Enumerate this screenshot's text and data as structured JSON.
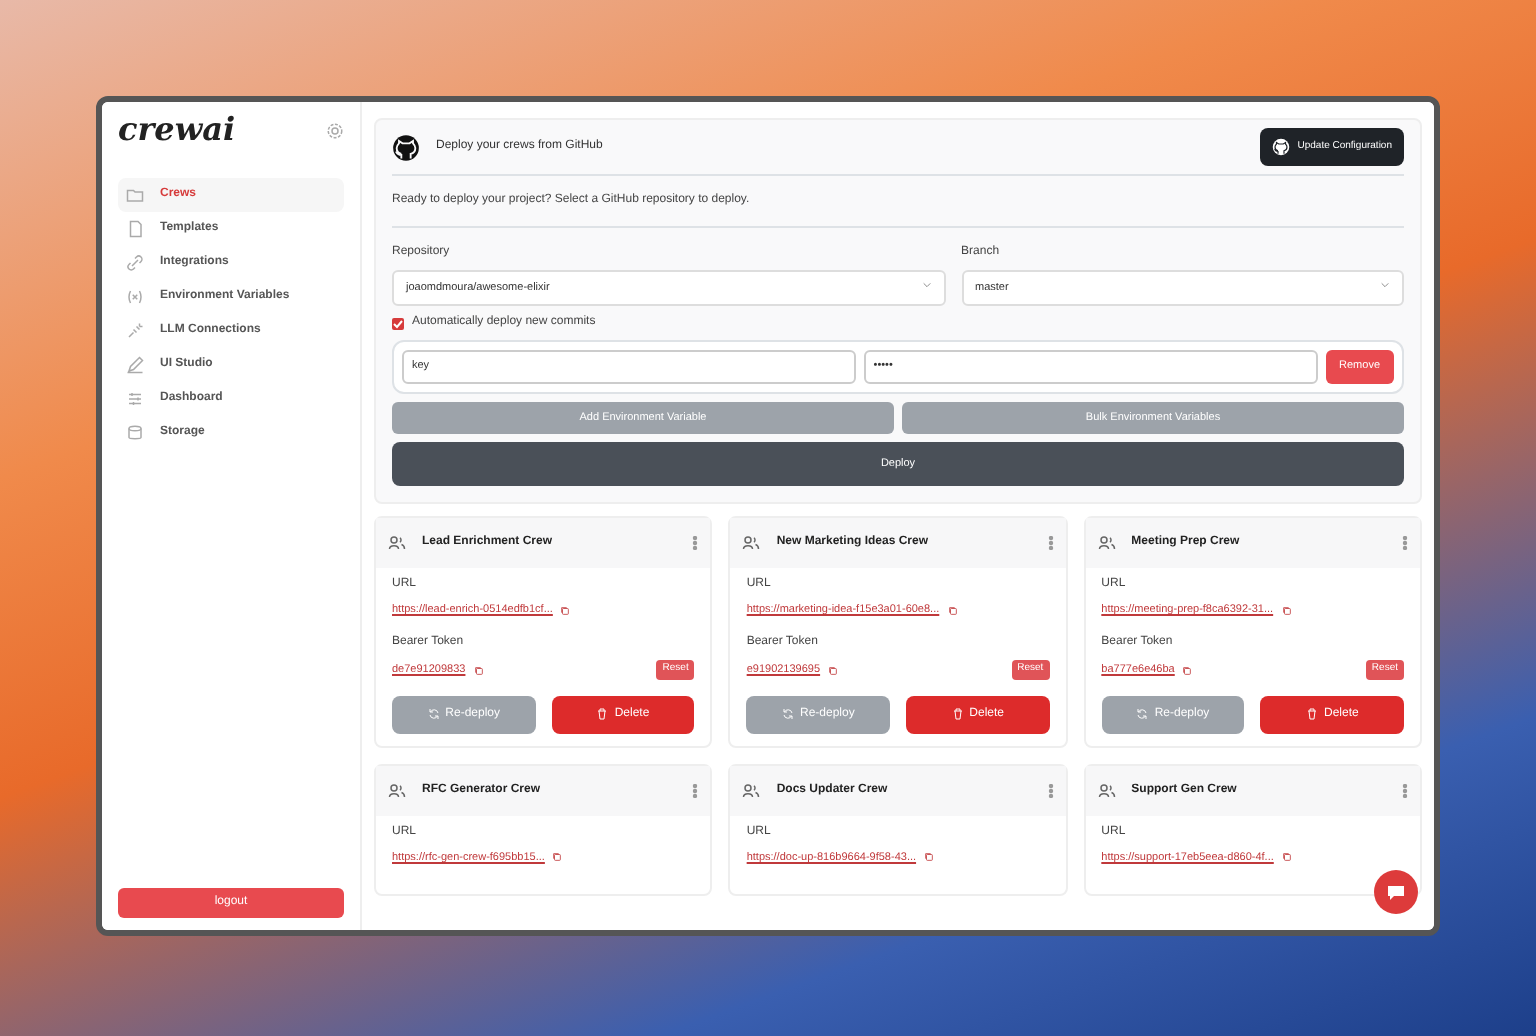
{
  "logo": {
    "text": "crewai"
  },
  "sidebar": {
    "items": [
      {
        "label": "Crews",
        "kind": "folder",
        "selected": true
      },
      {
        "label": "Templates",
        "kind": "copy",
        "selected": false
      },
      {
        "label": "Integrations",
        "kind": "link",
        "selected": false
      },
      {
        "label": "Environment Variables",
        "kind": "variable",
        "selected": false
      },
      {
        "label": "LLM Connections",
        "kind": "plug",
        "selected": false
      },
      {
        "label": "UI Studio",
        "kind": "pencil",
        "selected": false
      },
      {
        "label": "Dashboard",
        "kind": "sliders",
        "selected": false
      },
      {
        "label": "Storage",
        "kind": "database",
        "selected": false
      }
    ],
    "logout": "logout"
  },
  "deploy": {
    "title": "Deploy your crews from GitHub",
    "update_button": "Update Configuration",
    "intro": "Ready to deploy your project? Select a GitHub repository to deploy.",
    "repository": {
      "label": "Repository",
      "value": "joaomdmoura/awesome-elixir"
    },
    "branch": {
      "label": "Branch",
      "value": "master"
    },
    "auto_deploy": {
      "label": "Automatically deploy new commits",
      "checked": true
    },
    "env_vars": [
      {
        "key": "key",
        "value": "•••••",
        "remove": "Remove"
      }
    ],
    "add_button": "Add Environment Variable",
    "bulk_button": "Bulk Environment Variables",
    "deploy_button": "Deploy"
  },
  "crews": [
    {
      "name": "Lead Enrichment Crew",
      "url_label": "URL",
      "url": "https://lead-enrich-0514edfb1cf...",
      "token_label": "Bearer Token",
      "token": "de7e91209833",
      "reset": "Reset",
      "redeploy": "Re-deploy",
      "delete": "Delete"
    },
    {
      "name": "New Marketing Ideas Crew",
      "url_label": "URL",
      "url": "https://marketing-idea-f15e3a01-60e8...",
      "token_label": "Bearer Token",
      "token": "e91902139695",
      "reset": "Reset",
      "redeploy": "Re-deploy",
      "delete": "Delete"
    },
    {
      "name": "Meeting Prep Crew",
      "url_label": "URL",
      "url": "https://meeting-prep-f8ca6392-31...",
      "token_label": "Bearer Token",
      "token": "ba777e6e46ba",
      "reset": "Reset",
      "redeploy": "Re-deploy",
      "delete": "Delete"
    },
    {
      "name": "RFC Generator Crew",
      "url_label": "URL",
      "url": "https://rfc-gen-crew-f695bb15..."
    },
    {
      "name": "Docs Updater Crew",
      "url_label": "URL",
      "url": "https://doc-up-816b9664-9f58-43..."
    },
    {
      "name": "Support Gen Crew",
      "url_label": "URL",
      "url": "https://support-17eb5eea-d860-4f..."
    }
  ]
}
